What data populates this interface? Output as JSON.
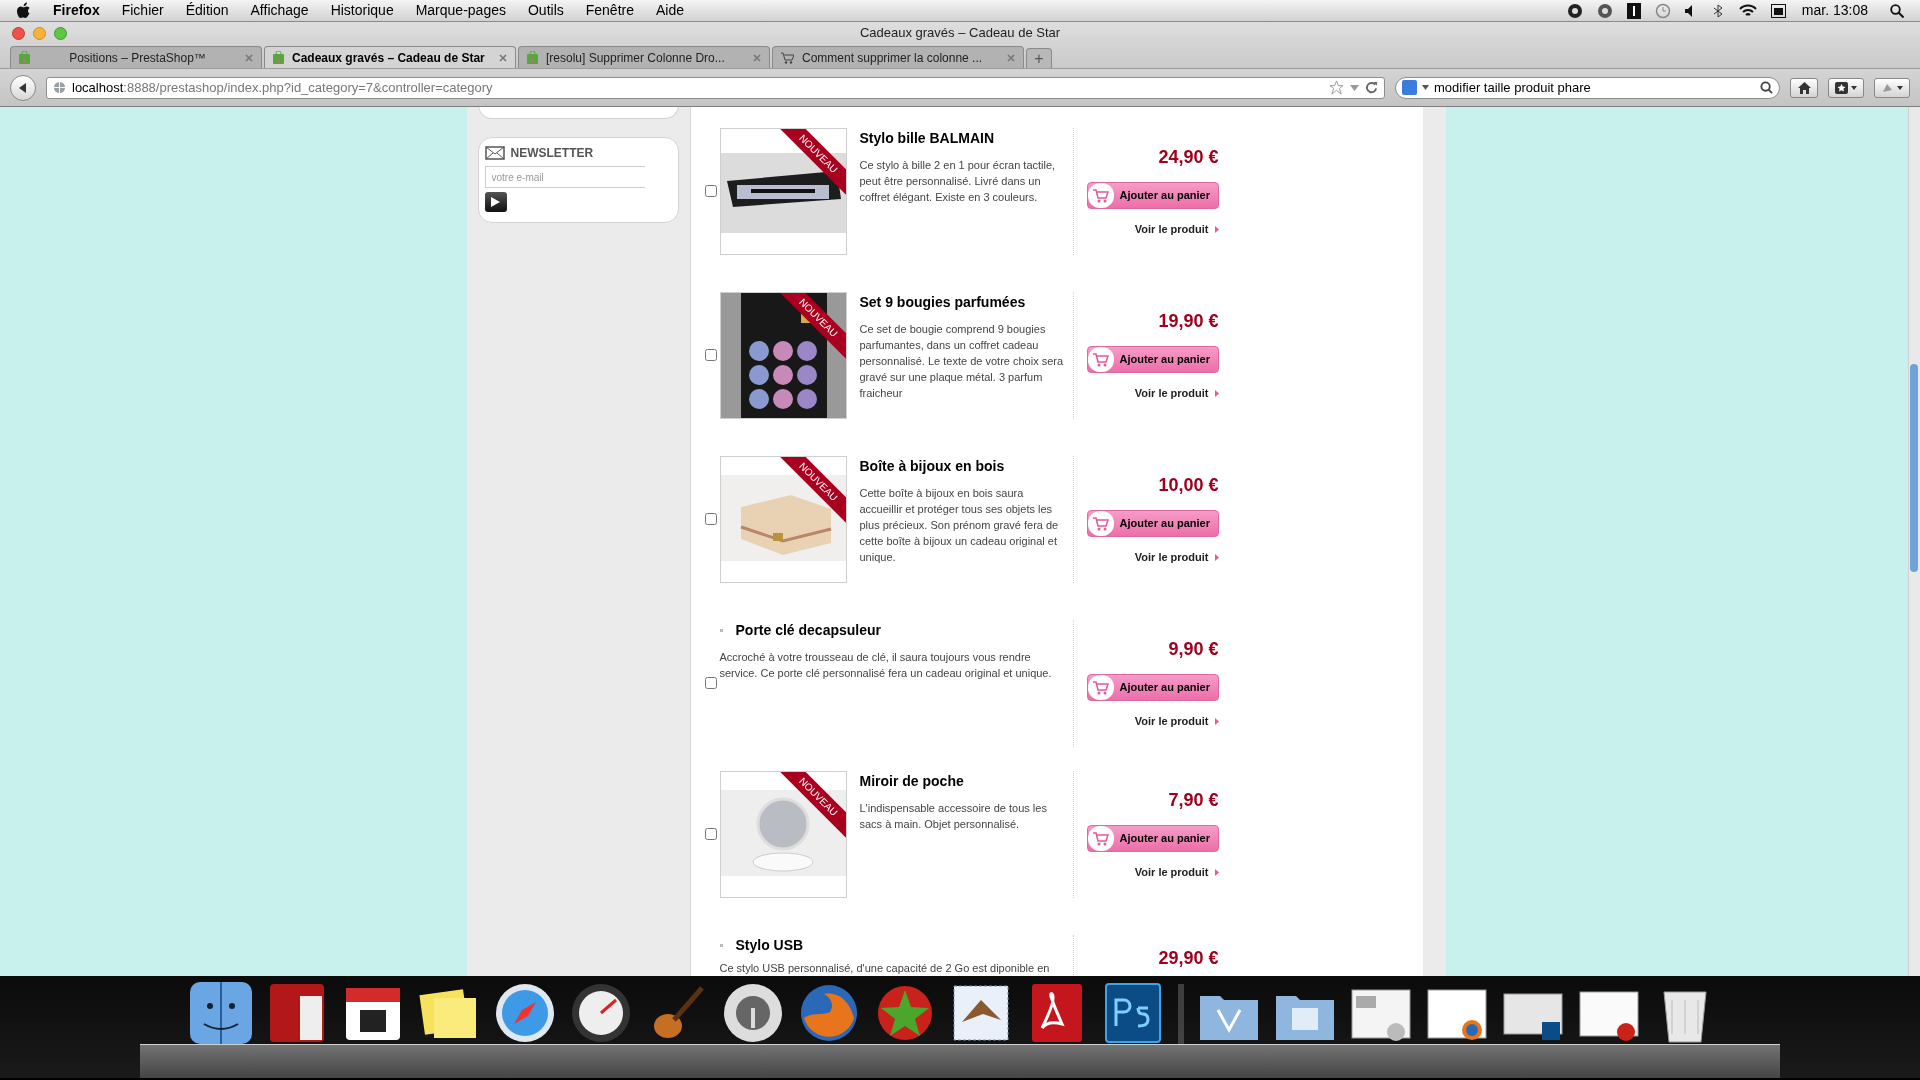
{
  "menu_bar": {
    "app": "Firefox",
    "items": [
      "Fichier",
      "Édition",
      "Affichage",
      "Historique",
      "Marque-pages",
      "Outils",
      "Fenêtre",
      "Aide"
    ],
    "clock": "mar. 13:08"
  },
  "window": {
    "title": "Cadeaux gravés – Cadeau de Star"
  },
  "tabs": [
    {
      "label": "Positions – PrestaShop™",
      "kind": "bag",
      "selected": false
    },
    {
      "label": "Cadeaux gravés – Cadeau de Star",
      "kind": "bag",
      "selected": true
    },
    {
      "label": "[resolu] Supprimer Colonne Dro...",
      "kind": "bag",
      "selected": false
    },
    {
      "label": "Comment supprimer la colonne ...",
      "kind": "cart",
      "selected": false
    }
  ],
  "new_tab": "+",
  "address_bar": {
    "host": "localhost",
    "path": ":8888/prestashop/index.php?id_category=7&controller=category"
  },
  "search": {
    "value": "modifier taille produit phare"
  },
  "sidebar": {
    "newsletter": {
      "title": "NEWSLETTER",
      "placeholder": "votre e-mail"
    }
  },
  "products": [
    {
      "kind": "image",
      "name": "Stylo bille BALMAIN",
      "badge": "NOUVEAU",
      "description": "Ce stylo à bille 2 en 1 pour écran tactile, peut être personnalisé.  Livré dans un coffret élégant. Existe en 3 couleurs.",
      "price": "24,90 €",
      "add_button": "Ajouter au panier",
      "link": "Voir le produit",
      "checked": false
    },
    {
      "kind": "image",
      "name": "Set 9 bougies parfumées",
      "badge": "NOUVEAU",
      "description": "Ce set de bougie comprend 9 bougies parfumantes, dans un coffret cadeau personnalisé. Le texte de votre choix sera gravé sur une plaque métal. 3 parfum fraicheur",
      "price": "19,90 €",
      "add_button": "Ajouter au panier",
      "link": "Voir le produit",
      "checked": false
    },
    {
      "kind": "image",
      "name": "Boîte à bijoux en bois",
      "badge": "NOUVEAU",
      "description": "Cette boîte à bijoux en bois saura accueillir et protéger tous ses objets les plus précieux. Son prénom gravé fera de cette boîte à bijoux un cadeau original et unique.",
      "price": "10,00 €",
      "add_button": "Ajouter au panier",
      "link": "Voir le produit",
      "checked": false
    },
    {
      "kind": "text",
      "name": "Porte clé decapsuleur",
      "description": "Accroché à votre trousseau de clé, il saura toujours vous rendre service. Ce porte clé personnalisé fera un cadeau original et unique.",
      "price": "9,90 €",
      "add_button": "Ajouter au panier",
      "link": "Voir le produit",
      "checked": false
    },
    {
      "kind": "image",
      "name": "Miroir de poche",
      "badge": "NOUVEAU",
      "description": "L'indispensable accessoire de tous les sacs à main. Objet personnalisé.",
      "price": "7,90 €",
      "add_button": "Ajouter au panier",
      "link": "Voir le produit",
      "checked": false
    },
    {
      "kind": "text",
      "name": "Stylo USB",
      "description": "Ce stylo USB personnalisé, d'une capacité de 2 Go est diponible en",
      "price": "29,90 €"
    }
  ]
}
